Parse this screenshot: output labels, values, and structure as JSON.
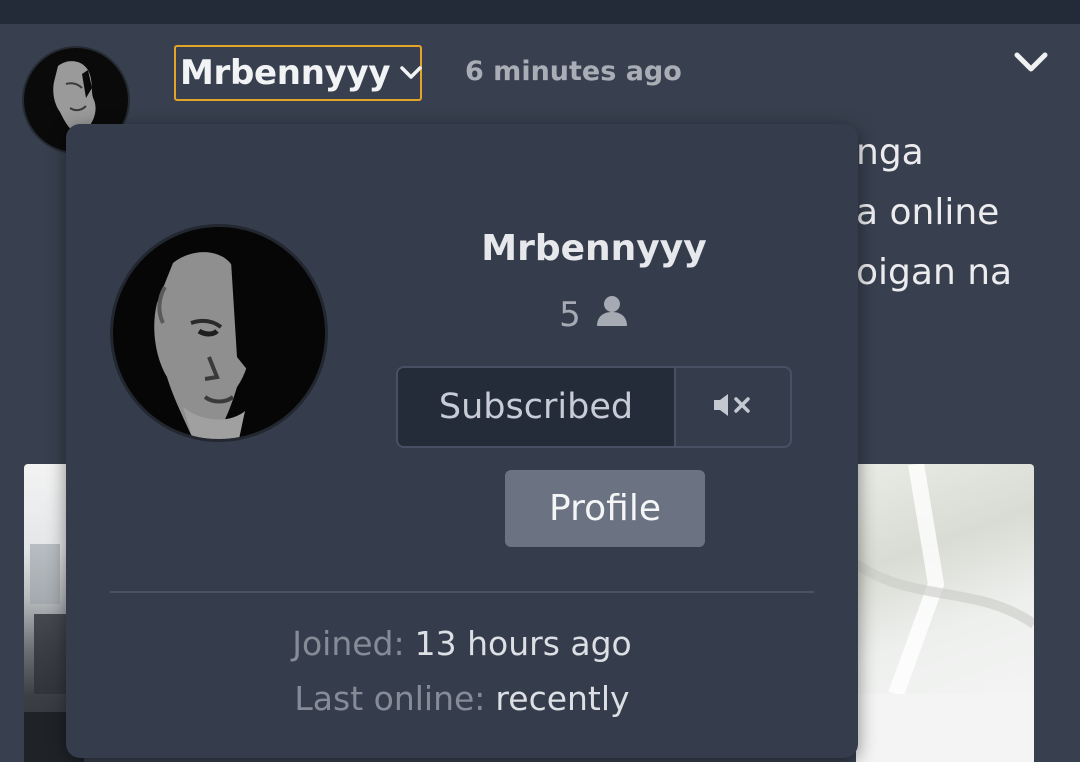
{
  "post": {
    "author": "Mrbennyyy",
    "timestamp": "6 minutes ago",
    "body_lines": [
      "nga",
      "a online",
      "oigan na"
    ]
  },
  "popup": {
    "name": "Mrbennyyy",
    "subscriber_count": "5",
    "subscribed_label": "Subscribed",
    "profile_label": "Profile",
    "joined_label": "Joined:",
    "joined_value": "13 hours ago",
    "last_online_label": "Last online:",
    "last_online_value": "recently"
  },
  "icons": {
    "username_dropdown": "chevron-down-icon",
    "post_menu": "chevron-down-icon",
    "subscribers": "user-icon",
    "mute": "mute-icon"
  },
  "colors": {
    "focus_outline": "#e2a52a",
    "background": "#38404f",
    "popup": "#353d4d",
    "profile_button": "#6b7382"
  }
}
